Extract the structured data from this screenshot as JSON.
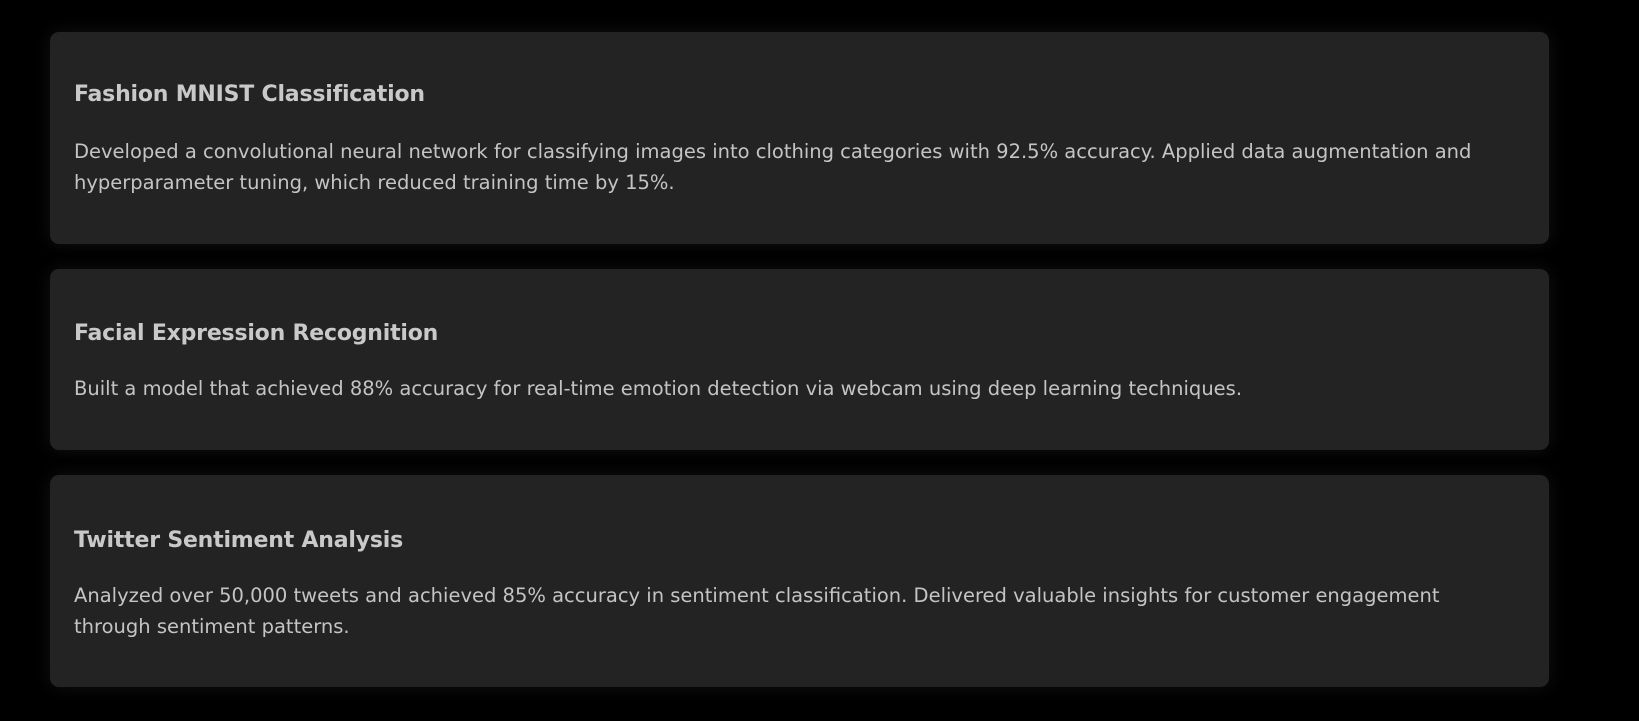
{
  "projects": [
    {
      "title": "Fashion MNIST Classification",
      "description": "Developed a convolutional neural network for classifying images into clothing categories with 92.5% accuracy. Applied data augmentation and hyperparameter tuning, which reduced training time by 15%."
    },
    {
      "title": "Facial Expression Recognition",
      "description": "Built a model that achieved 88% accuracy for real-time emotion detection via webcam using deep learning techniques."
    },
    {
      "title": "Twitter Sentiment Analysis",
      "description": "Analyzed over 50,000 tweets and achieved 85% accuracy in sentiment classification. Delivered valuable insights for customer engagement through sentiment patterns."
    }
  ],
  "colors": {
    "background": "#000000",
    "card": "#232323",
    "title": "#c9c9c9",
    "text": "#c4c4c4"
  }
}
